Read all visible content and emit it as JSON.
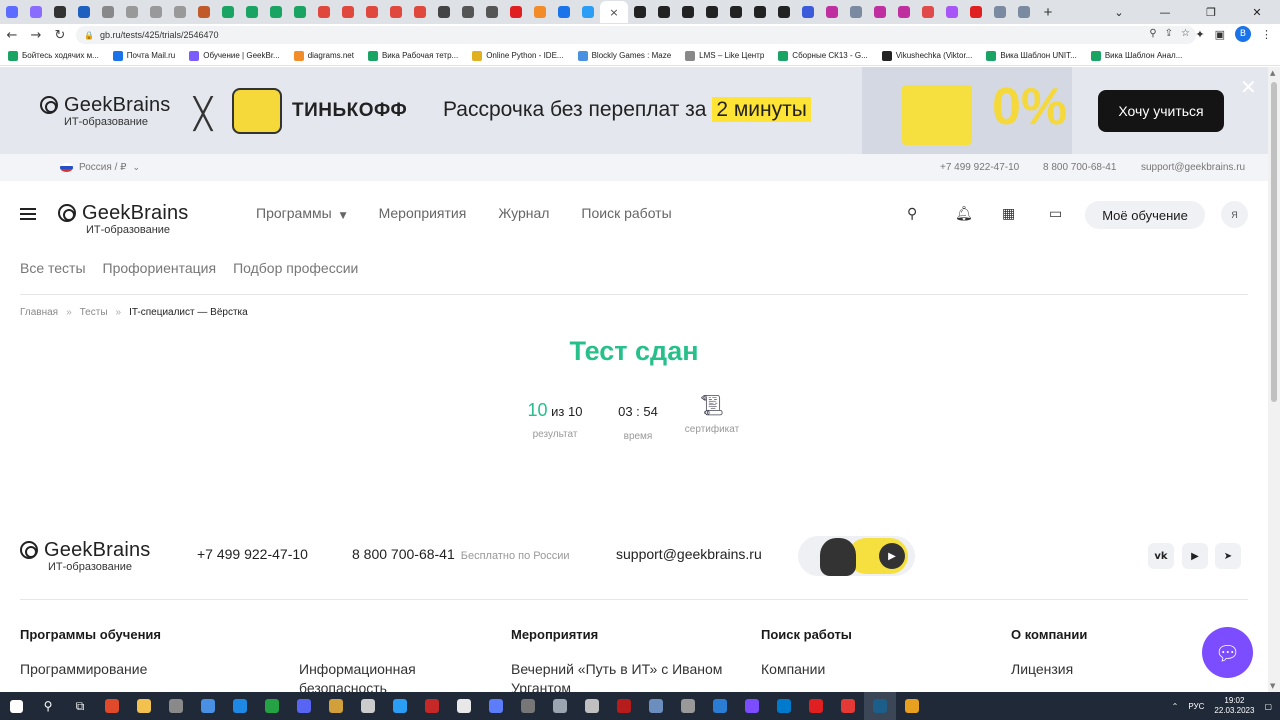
{
  "browser": {
    "tabs": [
      {
        "color": "#5b6cff"
      },
      {
        "color": "#8a6cff"
      },
      {
        "color": "#333333"
      },
      {
        "color": "#1f5fbf"
      },
      {
        "color": "#888888"
      },
      {
        "color": "#999999"
      },
      {
        "color": "#999999"
      },
      {
        "color": "#999999"
      },
      {
        "color": "#c05a2a"
      },
      {
        "color": "#19a463"
      },
      {
        "color": "#19a463"
      },
      {
        "color": "#19a463"
      },
      {
        "color": "#19a463"
      },
      {
        "color": "#e0483e"
      },
      {
        "color": "#e0483e"
      },
      {
        "color": "#e0483e"
      },
      {
        "color": "#e0483e"
      },
      {
        "color": "#e0483e"
      },
      {
        "color": "#444444"
      },
      {
        "color": "#555555"
      },
      {
        "color": "#555555"
      },
      {
        "color": "#e02020"
      },
      {
        "color": "#f28c28"
      },
      {
        "color": "#1a73e8"
      },
      {
        "color": "#2a9df4"
      }
    ],
    "tabs_after": [
      {
        "color": "#222222"
      },
      {
        "color": "#222222"
      },
      {
        "color": "#222222"
      },
      {
        "color": "#222222"
      },
      {
        "color": "#222222"
      },
      {
        "color": "#222222"
      },
      {
        "color": "#222222"
      },
      {
        "color": "#3b5bdb"
      },
      {
        "color": "#c02fa0"
      },
      {
        "color": "#7a8aa0"
      },
      {
        "color": "#c02fa0"
      },
      {
        "color": "#c02fa0"
      },
      {
        "color": "#e04a4a"
      },
      {
        "color": "#a855f7"
      },
      {
        "color": "#e02020"
      },
      {
        "color": "#7a8aa0"
      },
      {
        "color": "#7a8aa0"
      }
    ],
    "active_tab_close": "×",
    "new_tab": "+",
    "window_controls": {
      "chevron": "⌄",
      "minimize": "—",
      "maximize": "❐",
      "close": "✕"
    },
    "url": "gb.ru/tests/425/trials/2546470",
    "profile_initial": "B",
    "bookmarks": [
      {
        "label": "Бойтесь ходячих м...",
        "color": "#19a463"
      },
      {
        "label": "Почта Mail.ru",
        "color": "#1a73e8"
      },
      {
        "label": "Обучение | GeekBr...",
        "color": "#7a5cff"
      },
      {
        "label": "diagrams.net",
        "color": "#f28c28"
      },
      {
        "label": "Вика Рабочая тетр...",
        "color": "#19a463"
      },
      {
        "label": "Online Python - IDE...",
        "color": "#e0b020"
      },
      {
        "label": "Blockly Games : Maze",
        "color": "#4a90e2"
      },
      {
        "label": "LMS – Like Центр",
        "color": "#888888"
      },
      {
        "label": "Сборные СК13 - G...",
        "color": "#19a463"
      },
      {
        "label": "Vikushechka (Viktor...",
        "color": "#222222"
      },
      {
        "label": "Вика Шаблон UNIT...",
        "color": "#19a463"
      },
      {
        "label": "Вика Шаблон Анал...",
        "color": "#19a463"
      }
    ]
  },
  "promo": {
    "brand": "GeekBrains",
    "brand_sub": "ИТ-образование",
    "partner": "ТИНЬКОФФ",
    "text": "Рассрочка без переплат за",
    "highlight": "2 минуты",
    "art_percent": "0%",
    "cta": "Хочу учиться",
    "close": "✕"
  },
  "utility": {
    "region": "Россия / ₽",
    "phone1": "+7 499 922-47-10",
    "phone2": "8 800 700-68-41",
    "email": "support@geekbrains.ru"
  },
  "header": {
    "brand": "GeekBrains",
    "brand_sub": "ИТ-образование",
    "nav": [
      "Программы",
      "Мероприятия",
      "Журнал",
      "Поиск работы"
    ],
    "caret": "▼",
    "my_learning": "Моё обучение",
    "avatar": "Я"
  },
  "subnav": [
    "Все тесты",
    "Профориентация",
    "Подбор профессии"
  ],
  "breadcrumb": {
    "home": "Главная",
    "tests": "Тесты",
    "current": "IT-специалист — Вёрстка",
    "sep": "»"
  },
  "result": {
    "title": "Тест сдан",
    "score": "10",
    "score_of": "из 10",
    "score_label": "результат",
    "time": "03 : 54",
    "time_label": "время",
    "cert_label": "сертификат"
  },
  "footer": {
    "brand": "GeekBrains",
    "brand_sub": "ИТ-образование",
    "phone1": "+7 499 922-47-10",
    "phone2": "8 800 700-68-41",
    "phone2_note": "Бесплатно по России",
    "email": "support@geekbrains.ru",
    "social": [
      "vk",
      "▶",
      "➤"
    ],
    "columns": [
      {
        "heading": "Программы обучения",
        "items": [
          "Программирование",
          "Информационная безопасность"
        ]
      },
      {
        "heading": "Мероприятия",
        "items": [
          "Вечерний «Путь в ИТ» с Иваном Ургантом"
        ]
      },
      {
        "heading": "Поиск работы",
        "items": [
          "Компании"
        ]
      },
      {
        "heading": "О компании",
        "items": [
          "Лицензия"
        ]
      }
    ]
  },
  "taskbar": {
    "apps": [
      {
        "color": "#e04a2a"
      },
      {
        "color": "#f2c14e"
      },
      {
        "color": "#8a8a8a"
      },
      {
        "color": "#4a90e2"
      },
      {
        "color": "#1e88e5"
      },
      {
        "color": "#25a244"
      },
      {
        "color": "#5865f2"
      },
      {
        "color": "#d2a03a"
      },
      {
        "color": "#cccccc"
      },
      {
        "color": "#2a9df4"
      },
      {
        "color": "#c62828"
      },
      {
        "color": "#e8e8e8"
      },
      {
        "color": "#5c7cfa"
      },
      {
        "color": "#777777"
      },
      {
        "color": "#9aa5b1"
      },
      {
        "color": "#c0c0c0"
      },
      {
        "color": "#b71c1c"
      },
      {
        "color": "#6c8ebf"
      },
      {
        "color": "#999999"
      },
      {
        "color": "#2b7cd3"
      },
      {
        "color": "#7b4dff"
      },
      {
        "color": "#007acc"
      },
      {
        "color": "#e02020"
      },
      {
        "color": "#e53935"
      },
      {
        "color": "#1b5e8a"
      },
      {
        "color": "#e8a020"
      }
    ],
    "lang": "РУС",
    "time": "19:02",
    "date": "22.03.2023"
  }
}
